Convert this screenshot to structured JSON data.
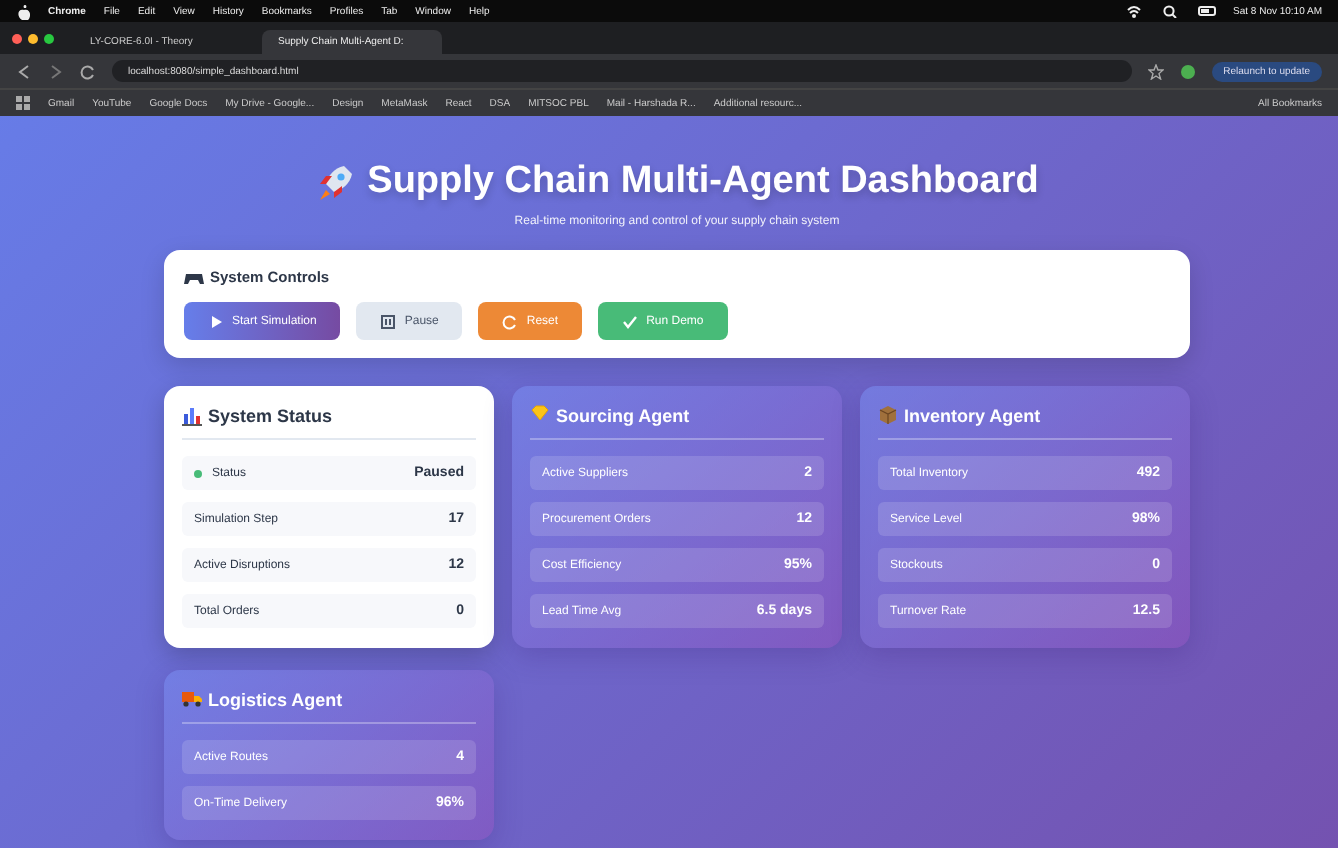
{
  "menu_bar": {
    "app": "Chrome",
    "items": [
      "File",
      "Edit",
      "View",
      "History",
      "Bookmarks",
      "Profiles",
      "Tab",
      "Window",
      "Help"
    ],
    "clock": "Sat 8 Nov 10:10 AM"
  },
  "tabs": [
    {
      "label": "LY-CORE-6.0I - Theory",
      "selected": false
    },
    {
      "label": "Supply Chain Multi-Agent D:",
      "selected": true
    }
  ],
  "address": "localhost:8080/simple_dashboard.html",
  "relaunch": "Relaunch to update",
  "bookmarks": [
    "Gmail",
    "YouTube",
    "Google Docs",
    "My Drive - Google...",
    "Design",
    "MetaMask",
    "React",
    "DSA",
    "MITSOC PBL",
    "Mail - Harshada R...",
    "Additional resourc..."
  ],
  "all_bookmarks": "All Bookmarks",
  "header": {
    "title": "Supply Chain Multi-Agent Dashboard",
    "subtitle": "Real-time monitoring and control of your supply chain system"
  },
  "controls": {
    "title": "System Controls",
    "buttons": [
      {
        "label": "Start Simulation",
        "kind": "primary"
      },
      {
        "label": "Pause",
        "kind": "secondary"
      },
      {
        "label": "Reset",
        "kind": "warning"
      },
      {
        "label": "Run Demo",
        "kind": "success"
      }
    ]
  },
  "cards": [
    {
      "title": "System Status",
      "kind": "status",
      "rows": [
        {
          "label": "Status",
          "value": "Paused",
          "color": "#48bb78"
        },
        {
          "label": "Simulation Step",
          "value": "17"
        },
        {
          "label": "Active Disruptions",
          "value": "12"
        },
        {
          "label": "Total Orders",
          "value": "0"
        }
      ]
    },
    {
      "title": "Sourcing Agent",
      "kind": "sourcing",
      "rows": [
        {
          "label": "Active Suppliers",
          "value": "2"
        },
        {
          "label": "Procurement Orders",
          "value": "12"
        },
        {
          "label": "Cost Efficiency",
          "value": "95%"
        },
        {
          "label": "Lead Time Avg",
          "value": "6.5 days"
        }
      ]
    },
    {
      "title": "Inventory Agent",
      "kind": "inventory",
      "rows": [
        {
          "label": "Total Inventory",
          "value": "492"
        },
        {
          "label": "Service Level",
          "value": "98%"
        },
        {
          "label": "Stockouts",
          "value": "0"
        },
        {
          "label": "Turnover Rate",
          "value": "12.5"
        }
      ]
    },
    {
      "title": "Logistics Agent",
      "kind": "logistics",
      "rows": [
        {
          "label": "Active Routes",
          "value": "4"
        },
        {
          "label": "On-Time Delivery",
          "value": "96%"
        }
      ]
    }
  ]
}
